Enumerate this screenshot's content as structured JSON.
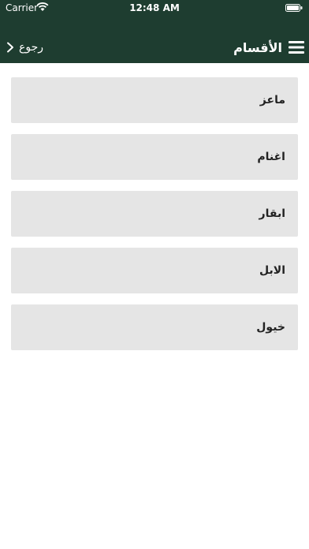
{
  "status_bar": {
    "carrier": "Carrier",
    "time": "12:48 AM"
  },
  "nav": {
    "back_label": "رجوع",
    "title": "الأقسام",
    "menu_icon": "hamburger-menu-icon",
    "back_icon": "chevron-right-icon"
  },
  "colors": {
    "header_bg": "#1e3d30",
    "item_bg": "#e5e5e5"
  },
  "categories": [
    {
      "label": "ماعز"
    },
    {
      "label": "اغنام"
    },
    {
      "label": "ابقار"
    },
    {
      "label": "الابل"
    },
    {
      "label": "خيول"
    }
  ]
}
